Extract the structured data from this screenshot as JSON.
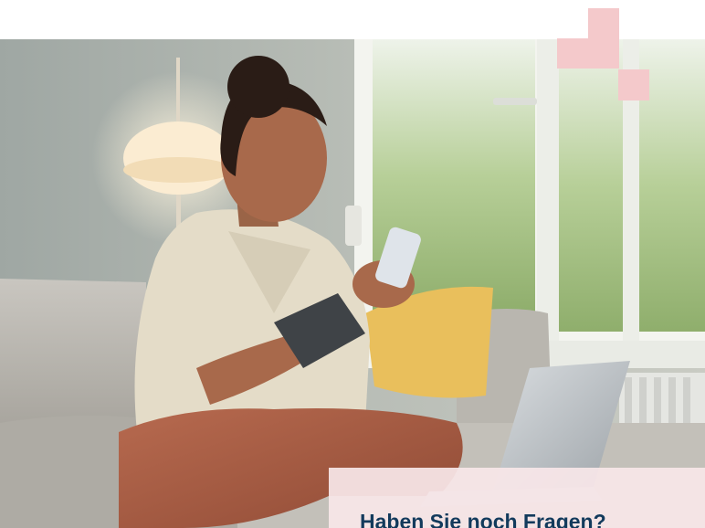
{
  "hero": {
    "image_description_icon": "photo-woman-smartphone-wrist-brace"
  },
  "question_card": {
    "title": "Haben Sie noch Fragen?"
  },
  "colors": {
    "accent_pink": "#f4c9cb",
    "card_background": "#f7e6e8",
    "heading_text": "#123a5c"
  }
}
